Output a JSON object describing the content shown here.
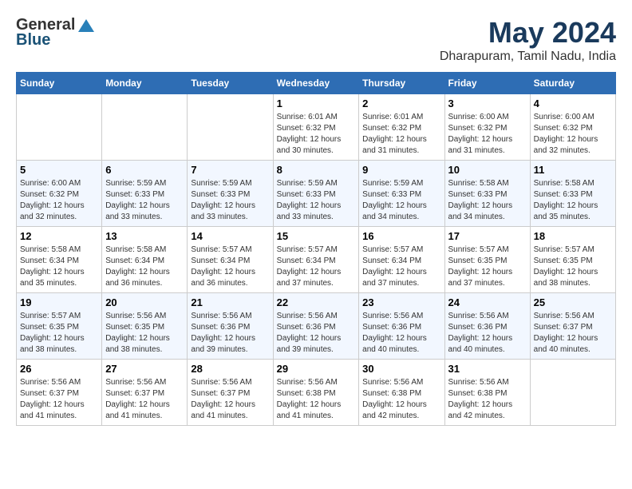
{
  "header": {
    "logo_general": "General",
    "logo_blue": "Blue",
    "title": "May 2024",
    "subtitle": "Dharapuram, Tamil Nadu, India"
  },
  "days": [
    "Sunday",
    "Monday",
    "Tuesday",
    "Wednesday",
    "Thursday",
    "Friday",
    "Saturday"
  ],
  "weeks": [
    [
      {
        "date": "",
        "info": ""
      },
      {
        "date": "",
        "info": ""
      },
      {
        "date": "",
        "info": ""
      },
      {
        "date": "1",
        "info": "Sunrise: 6:01 AM\nSunset: 6:32 PM\nDaylight: 12 hours\nand 30 minutes."
      },
      {
        "date": "2",
        "info": "Sunrise: 6:01 AM\nSunset: 6:32 PM\nDaylight: 12 hours\nand 31 minutes."
      },
      {
        "date": "3",
        "info": "Sunrise: 6:00 AM\nSunset: 6:32 PM\nDaylight: 12 hours\nand 31 minutes."
      },
      {
        "date": "4",
        "info": "Sunrise: 6:00 AM\nSunset: 6:32 PM\nDaylight: 12 hours\nand 32 minutes."
      }
    ],
    [
      {
        "date": "5",
        "info": "Sunrise: 6:00 AM\nSunset: 6:32 PM\nDaylight: 12 hours\nand 32 minutes."
      },
      {
        "date": "6",
        "info": "Sunrise: 5:59 AM\nSunset: 6:33 PM\nDaylight: 12 hours\nand 33 minutes."
      },
      {
        "date": "7",
        "info": "Sunrise: 5:59 AM\nSunset: 6:33 PM\nDaylight: 12 hours\nand 33 minutes."
      },
      {
        "date": "8",
        "info": "Sunrise: 5:59 AM\nSunset: 6:33 PM\nDaylight: 12 hours\nand 33 minutes."
      },
      {
        "date": "9",
        "info": "Sunrise: 5:59 AM\nSunset: 6:33 PM\nDaylight: 12 hours\nand 34 minutes."
      },
      {
        "date": "10",
        "info": "Sunrise: 5:58 AM\nSunset: 6:33 PM\nDaylight: 12 hours\nand 34 minutes."
      },
      {
        "date": "11",
        "info": "Sunrise: 5:58 AM\nSunset: 6:33 PM\nDaylight: 12 hours\nand 35 minutes."
      }
    ],
    [
      {
        "date": "12",
        "info": "Sunrise: 5:58 AM\nSunset: 6:34 PM\nDaylight: 12 hours\nand 35 minutes."
      },
      {
        "date": "13",
        "info": "Sunrise: 5:58 AM\nSunset: 6:34 PM\nDaylight: 12 hours\nand 36 minutes."
      },
      {
        "date": "14",
        "info": "Sunrise: 5:57 AM\nSunset: 6:34 PM\nDaylight: 12 hours\nand 36 minutes."
      },
      {
        "date": "15",
        "info": "Sunrise: 5:57 AM\nSunset: 6:34 PM\nDaylight: 12 hours\nand 37 minutes."
      },
      {
        "date": "16",
        "info": "Sunrise: 5:57 AM\nSunset: 6:34 PM\nDaylight: 12 hours\nand 37 minutes."
      },
      {
        "date": "17",
        "info": "Sunrise: 5:57 AM\nSunset: 6:35 PM\nDaylight: 12 hours\nand 37 minutes."
      },
      {
        "date": "18",
        "info": "Sunrise: 5:57 AM\nSunset: 6:35 PM\nDaylight: 12 hours\nand 38 minutes."
      }
    ],
    [
      {
        "date": "19",
        "info": "Sunrise: 5:57 AM\nSunset: 6:35 PM\nDaylight: 12 hours\nand 38 minutes."
      },
      {
        "date": "20",
        "info": "Sunrise: 5:56 AM\nSunset: 6:35 PM\nDaylight: 12 hours\nand 38 minutes."
      },
      {
        "date": "21",
        "info": "Sunrise: 5:56 AM\nSunset: 6:36 PM\nDaylight: 12 hours\nand 39 minutes."
      },
      {
        "date": "22",
        "info": "Sunrise: 5:56 AM\nSunset: 6:36 PM\nDaylight: 12 hours\nand 39 minutes."
      },
      {
        "date": "23",
        "info": "Sunrise: 5:56 AM\nSunset: 6:36 PM\nDaylight: 12 hours\nand 40 minutes."
      },
      {
        "date": "24",
        "info": "Sunrise: 5:56 AM\nSunset: 6:36 PM\nDaylight: 12 hours\nand 40 minutes."
      },
      {
        "date": "25",
        "info": "Sunrise: 5:56 AM\nSunset: 6:37 PM\nDaylight: 12 hours\nand 40 minutes."
      }
    ],
    [
      {
        "date": "26",
        "info": "Sunrise: 5:56 AM\nSunset: 6:37 PM\nDaylight: 12 hours\nand 41 minutes."
      },
      {
        "date": "27",
        "info": "Sunrise: 5:56 AM\nSunset: 6:37 PM\nDaylight: 12 hours\nand 41 minutes."
      },
      {
        "date": "28",
        "info": "Sunrise: 5:56 AM\nSunset: 6:37 PM\nDaylight: 12 hours\nand 41 minutes."
      },
      {
        "date": "29",
        "info": "Sunrise: 5:56 AM\nSunset: 6:38 PM\nDaylight: 12 hours\nand 41 minutes."
      },
      {
        "date": "30",
        "info": "Sunrise: 5:56 AM\nSunset: 6:38 PM\nDaylight: 12 hours\nand 42 minutes."
      },
      {
        "date": "31",
        "info": "Sunrise: 5:56 AM\nSunset: 6:38 PM\nDaylight: 12 hours\nand 42 minutes."
      },
      {
        "date": "",
        "info": ""
      }
    ]
  ]
}
